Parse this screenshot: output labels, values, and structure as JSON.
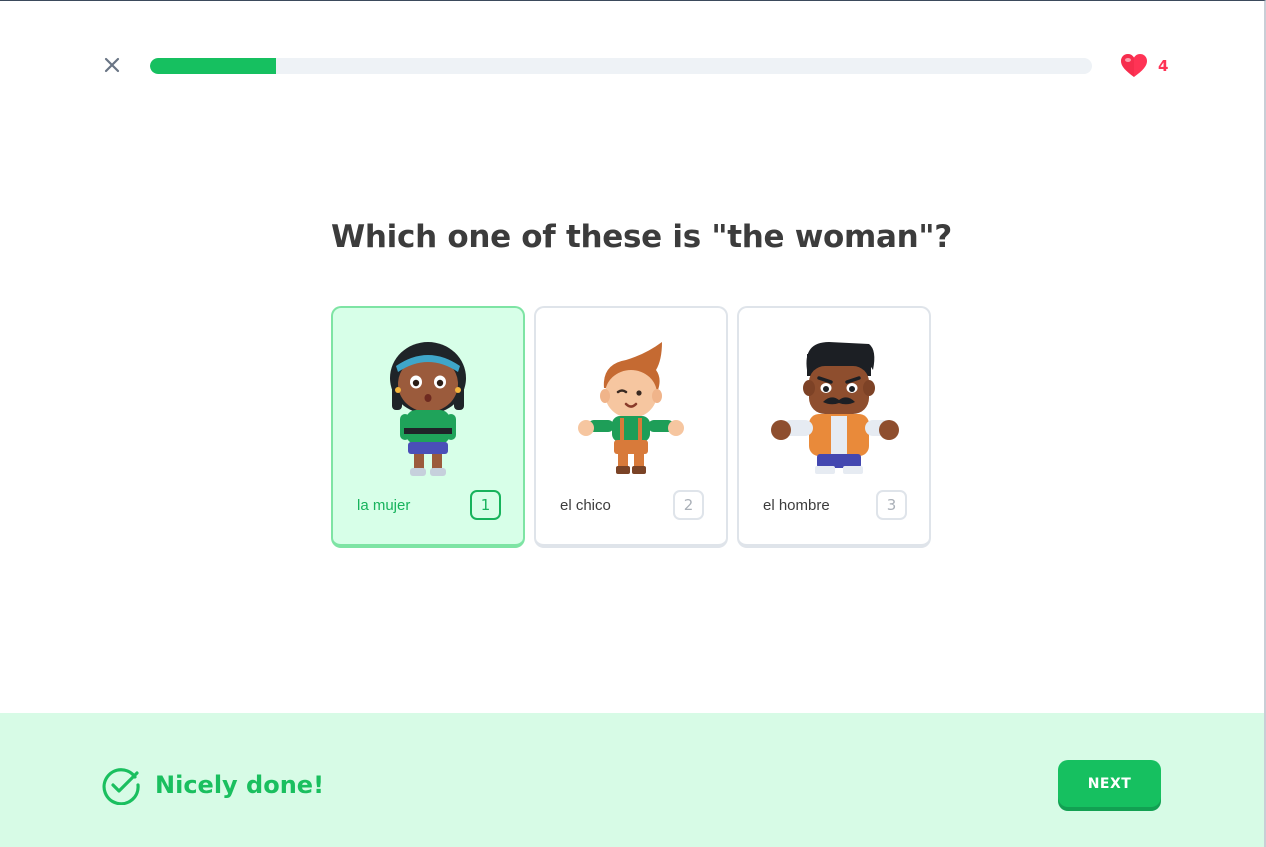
{
  "header": {
    "close_icon": "close-icon",
    "progress": {
      "fraction": 0.134,
      "color": "#16c060",
      "track_color": "#eef2f6"
    },
    "hearts": {
      "icon": "heart-icon",
      "count": "4",
      "color": "#ff3355"
    }
  },
  "question": {
    "text": "Which one of these is \"the woman\"?"
  },
  "choices": [
    {
      "label": "la mujer",
      "key": "1",
      "selected": true,
      "character": "woman-character-image"
    },
    {
      "label": "el chico",
      "key": "2",
      "selected": false,
      "character": "boy-character-image"
    },
    {
      "label": "el hombre",
      "key": "3",
      "selected": false,
      "character": "man-character-image"
    }
  ],
  "footer": {
    "feedback_icon": "checkmark-circle-icon",
    "feedback_text": "Nicely done!",
    "next_label": "NEXT",
    "background": "#d7fbe6",
    "accent": "#16c060"
  }
}
